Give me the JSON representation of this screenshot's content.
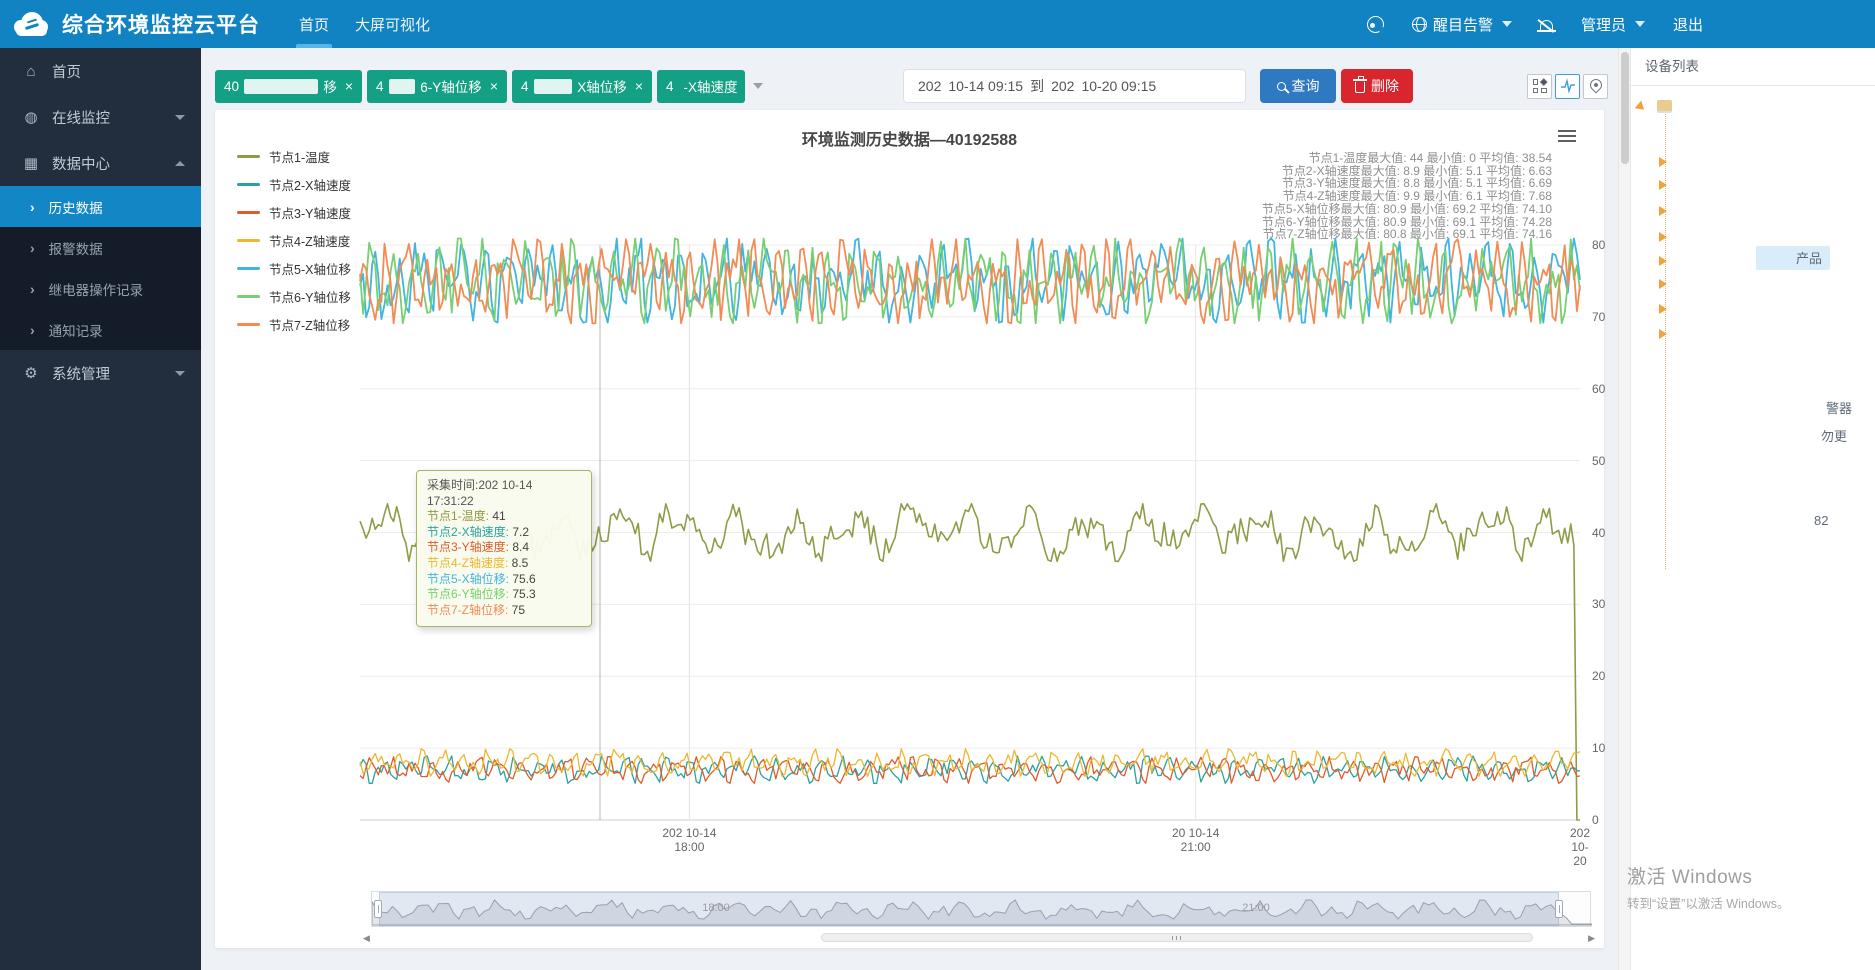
{
  "navbar": {
    "title": "综合环境监控云平台",
    "items": [
      {
        "label": "首页",
        "active": true
      },
      {
        "label": "大屏可视化",
        "active": false
      }
    ],
    "alarm_label": "醒目告警",
    "admin_label": "管理员",
    "logout_label": "退出"
  },
  "sidebar": {
    "items": [
      {
        "label": "首页",
        "icon": "home-icon",
        "type": "top",
        "glyph": "⌂"
      },
      {
        "label": "在线监控",
        "icon": "globe-icon",
        "type": "top",
        "glyph": "◍",
        "caret": "down"
      },
      {
        "label": "数据中心",
        "icon": "data-grid-icon",
        "type": "top",
        "glyph": "▦",
        "caret": "up",
        "expanded": true
      },
      {
        "label": "历史数据",
        "type": "sub",
        "active": true
      },
      {
        "label": "报警数据",
        "type": "sub"
      },
      {
        "label": "继电器操作记录",
        "type": "sub"
      },
      {
        "label": "通知记录",
        "type": "sub"
      },
      {
        "label": "系统管理",
        "icon": "gear-icon",
        "type": "top",
        "glyph": "⚙",
        "caret": "down"
      }
    ]
  },
  "filters": {
    "chips": [
      {
        "prefix": "40",
        "suffix": "移",
        "closable": true
      },
      {
        "prefix": "4",
        "suffix": "6-Y轴位移",
        "closable": true
      },
      {
        "prefix": "4",
        "suffix": "X轴位移",
        "closable": true
      },
      {
        "prefix": "4",
        "suffix": "-X轴速度",
        "closable": false
      }
    ],
    "date_range": {
      "start_year": "202",
      "start_rest": "10-14 09:15",
      "separator": "到",
      "end_year": "202",
      "end_rest": "10-20 09:15"
    },
    "query_label": "查询",
    "delete_label": "删除"
  },
  "chart_data": {
    "type": "line",
    "title": "环境监测历史数据—40192588",
    "legend_position": "left-vertical",
    "grid": true,
    "y_axis": {
      "position": "right",
      "min": 0,
      "max": 80,
      "tick_step": 10,
      "ticks": [
        80,
        70,
        60,
        50,
        40,
        30,
        20,
        10,
        0
      ]
    },
    "x_axis": {
      "ticks": [
        {
          "line1": "202 10-14",
          "line2": "18:00",
          "pos": 0.27
        },
        {
          "line1": "20 10-14",
          "line2": "21:00",
          "pos": 0.685
        },
        {
          "line1": "202",
          "line2": "10-20",
          "pos": 1.0
        }
      ]
    },
    "series": [
      {
        "name": "节点1-温度",
        "color": "#8f9b46",
        "max": 44,
        "min": 0,
        "avg": 38.54,
        "band": [
          36,
          44
        ],
        "drops_to_zero_at_end": true
      },
      {
        "name": "节点2-X轴速度",
        "color": "#2aa1a0",
        "max": 8.9,
        "min": 5.1,
        "avg": 6.63,
        "band": [
          5.1,
          8.9
        ]
      },
      {
        "name": "节点3-Y轴速度",
        "color": "#df5b2b",
        "max": 8.8,
        "min": 5.1,
        "avg": 6.69,
        "band": [
          5.1,
          8.8
        ]
      },
      {
        "name": "节点4-Z轴速度",
        "color": "#edb72f",
        "max": 9.9,
        "min": 6.1,
        "avg": 7.68,
        "band": [
          6.1,
          9.9
        ]
      },
      {
        "name": "节点5-X轴位移",
        "color": "#41b4df",
        "max": 80.9,
        "min": 69.2,
        "avg": 74.1,
        "band": [
          69.2,
          80.9
        ]
      },
      {
        "name": "节点6-Y轴位移",
        "color": "#76d071",
        "max": 80.9,
        "min": 69.1,
        "avg": 74.28,
        "band": [
          69.1,
          80.9
        ]
      },
      {
        "name": "节点7-Z轴位移",
        "color": "#f28b54",
        "max": 80.8,
        "min": 69.1,
        "avg": 74.16,
        "band": [
          69.1,
          80.8
        ]
      }
    ],
    "stats_lines": [
      "节点1-温度最大值: 44 最小值: 0 平均值: 38.54",
      "节点2-X轴速度最大值: 8.9 最小值: 5.1 平均值: 6.63",
      "节点3-Y轴速度最大值: 8.8 最小值: 5.1 平均值: 6.69",
      "节点4-Z轴速度最大值: 9.9 最小值: 6.1 平均值: 7.68",
      "节点5-X轴位移最大值: 80.9 最小值: 69.2 平均值: 74.10",
      "节点6-Y轴位移最大值: 80.9 最小值: 69.1 平均值: 74.28",
      "节点7-Z轴位移最大值: 80.8 最小值: 69.1 平均值: 74.16"
    ],
    "datazoom": {
      "labels": [
        "18:00",
        "21:00"
      ]
    }
  },
  "tooltip": {
    "time_prefix": "采集时间:202",
    "time_suffix": "10-14 17:31:22",
    "values": [
      "41",
      "7.2",
      "8.4",
      "8.5",
      "75.6",
      "75.3",
      "75"
    ]
  },
  "device_panel": {
    "title": "设备列表",
    "fragments": [
      {
        "text": "产品",
        "highlight": true
      },
      {
        "text": "警器",
        "highlight": false
      },
      {
        "text": "勿更",
        "highlight": false
      },
      {
        "text": "82",
        "highlight": false
      }
    ]
  },
  "watermark": {
    "line1": "激活 Windows",
    "line2": "转到“设置”以激活 Windows。"
  }
}
